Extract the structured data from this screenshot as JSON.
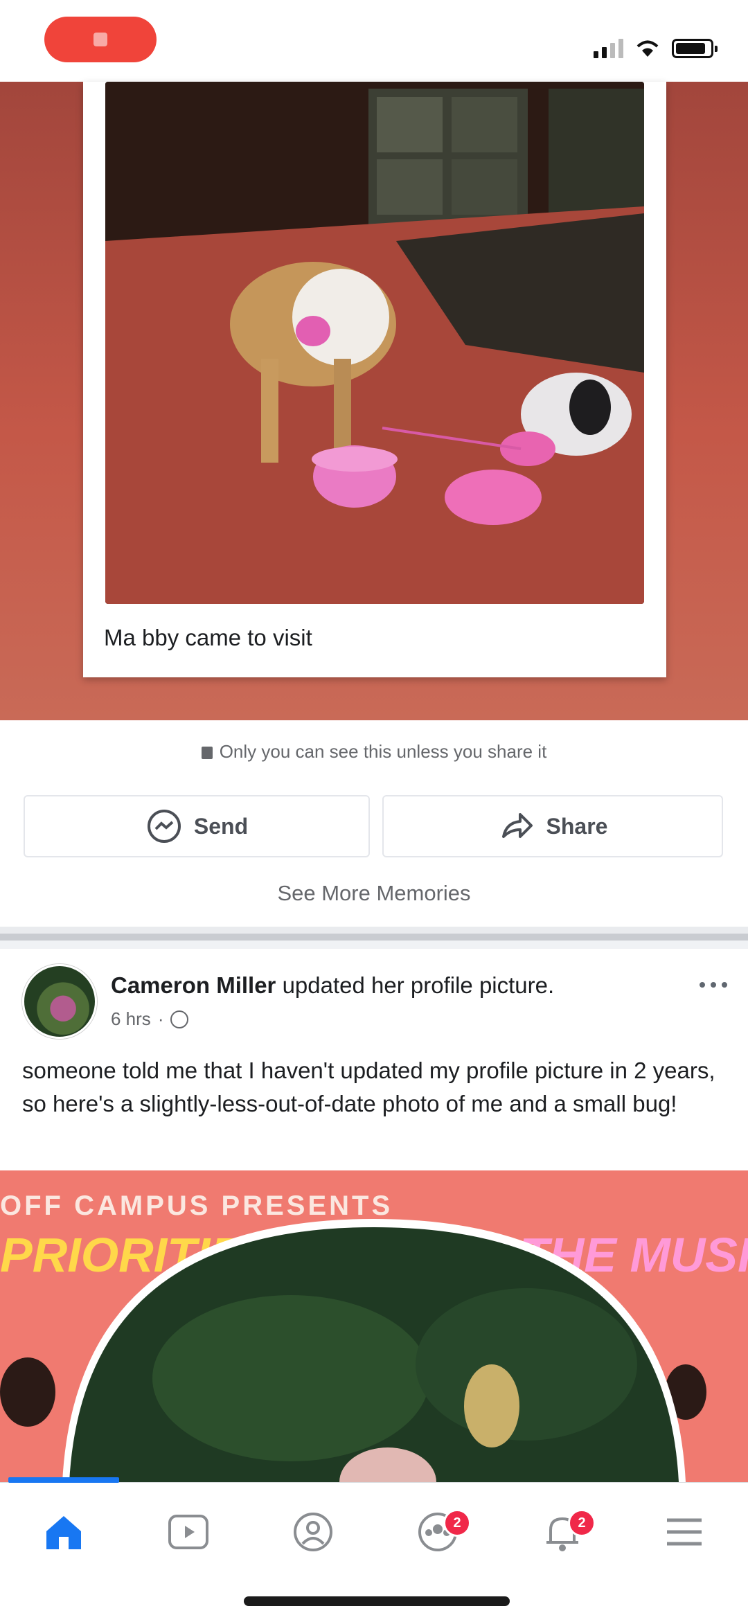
{
  "memory": {
    "caption": "Ma bby came to visit",
    "privacy_note": "Only you can see this unless you share it",
    "send_label": "Send",
    "share_label": "Share",
    "see_more": "See More Memories"
  },
  "post": {
    "author": "Cameron Miller",
    "action": "updated her profile picture.",
    "time": "6 hrs",
    "text": "someone told me that I haven't updated my profile picture in 2 years, so here's a slightly-less-out-of-date photo of me and a small bug!"
  },
  "poster": {
    "line1": "OFF CAMPUS PRESENTS",
    "line2": "PRIORITIES",
    "line3": "THE MUSIC"
  },
  "nav": {
    "items": [
      {
        "name": "home",
        "active": true
      },
      {
        "name": "watch",
        "active": false
      },
      {
        "name": "profile",
        "active": false
      },
      {
        "name": "groups",
        "badge": "2"
      },
      {
        "name": "notifications",
        "badge": "2"
      },
      {
        "name": "menu",
        "active": false
      }
    ],
    "accent": "#1877f2",
    "badge_color": "#f02849"
  },
  "colors": {
    "memory_bg": "#c45848",
    "recording": "#f0443a"
  }
}
